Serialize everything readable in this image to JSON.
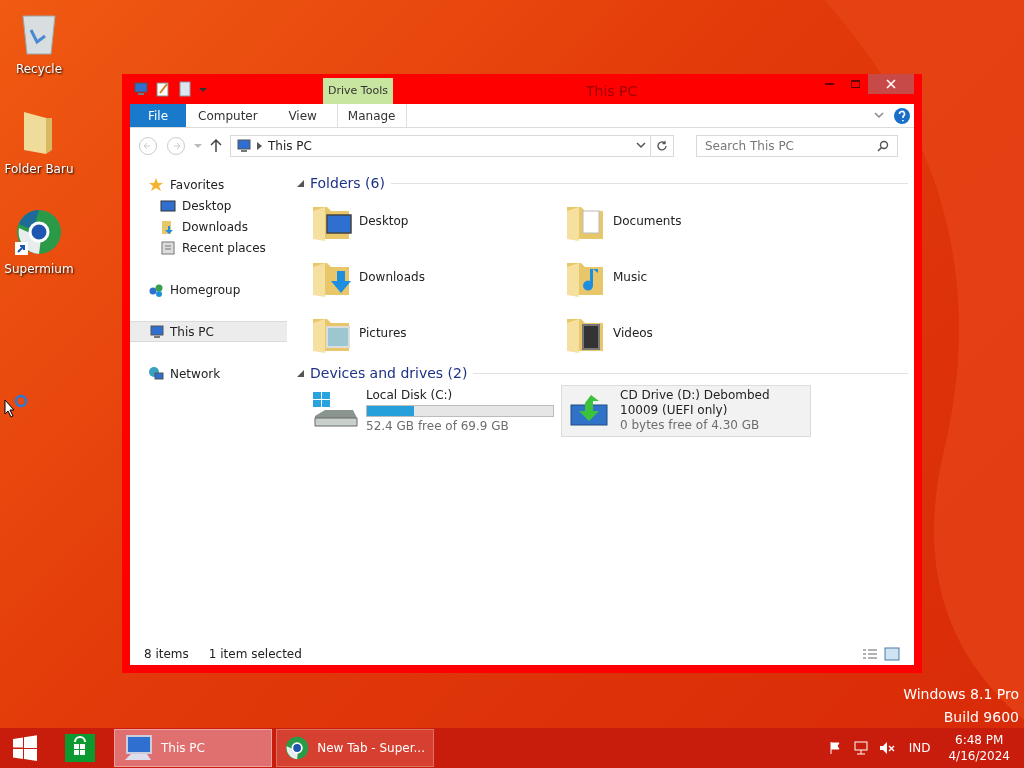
{
  "desktop_icons": [
    {
      "label": "Recycle",
      "kind": "bin"
    },
    {
      "label": "Folder Baru",
      "kind": "folder"
    },
    {
      "label": "Supermium",
      "kind": "browser"
    }
  ],
  "window": {
    "title": "This PC",
    "context_group": "Drive Tools",
    "ribbon_tabs": [
      {
        "label": "File",
        "kind": "file"
      },
      {
        "label": "Computer",
        "kind": "tab"
      },
      {
        "label": "View",
        "kind": "tab"
      },
      {
        "label": "Manage",
        "kind": "context"
      }
    ],
    "address": "This PC",
    "search": {
      "placeholder": "Search This PC"
    },
    "nav": [
      {
        "label": "Favorites",
        "kind": "star",
        "selected": false,
        "children": [
          {
            "label": "Desktop",
            "kind": "desktop",
            "selected": false
          },
          {
            "label": "Downloads",
            "kind": "downloads",
            "selected": false
          },
          {
            "label": "Recent places",
            "kind": "recent",
            "selected": false
          }
        ]
      },
      {
        "label": "Homegroup",
        "kind": "homegroup",
        "selected": false
      },
      {
        "label": "This PC",
        "kind": "pc",
        "selected": true
      },
      {
        "label": "Network",
        "kind": "network",
        "selected": false
      }
    ],
    "folders": {
      "heading": "Folders (6)",
      "items": [
        {
          "name": "Desktop",
          "kind": "desktop"
        },
        {
          "name": "Documents",
          "kind": "documents"
        },
        {
          "name": "Downloads",
          "kind": "downloads"
        },
        {
          "name": "Music",
          "kind": "music"
        },
        {
          "name": "Pictures",
          "kind": "pictures"
        },
        {
          "name": "Videos",
          "kind": "videos"
        }
      ]
    },
    "devices": {
      "heading": "Devices and drives (2)",
      "items": [
        {
          "name": "Local Disk (C:)",
          "kind": "disk",
          "level": 0.25,
          "free": "52.4 GB free of 69.9 GB",
          "selected": false
        },
        {
          "name": "CD Drive (D:) Debombed 10009 (UEFI only)",
          "kind": "cd",
          "free": "0 bytes free of 4.30 GB",
          "selected": true
        }
      ]
    },
    "status": {
      "count": "8 items",
      "selection": "1 item selected"
    }
  },
  "watermark": {
    "edition": "Windows 8.1 Pro",
    "build": "Build 9600"
  },
  "taskbar": {
    "buttons": [
      {
        "label": "This PC",
        "kind": "explorer",
        "selected": true
      },
      {
        "label": "New Tab - Super...",
        "kind": "browser",
        "selected": false
      }
    ],
    "language": "IND",
    "time": "6:48 PM",
    "date": "4/16/2024"
  }
}
